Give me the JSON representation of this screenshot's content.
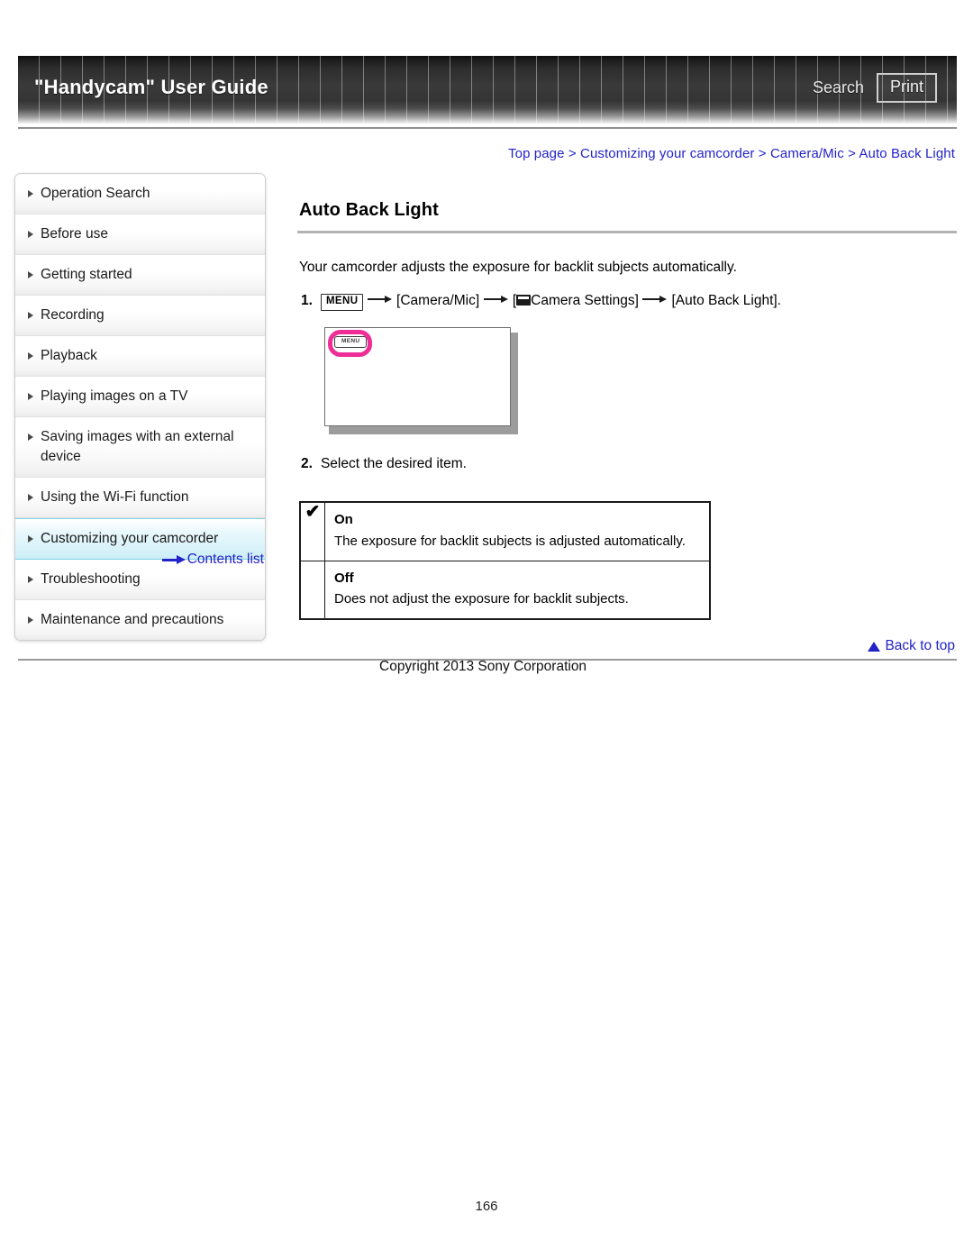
{
  "header": {
    "title": "\"Handycam\" User Guide",
    "search_label": "Search",
    "print_label": "Print"
  },
  "breadcrumb": {
    "full": "Top page > Customizing your camcorder > Camera/Mic > Auto Back Light",
    "items": [
      "Top page",
      "Customizing your camcorder",
      "Camera/Mic",
      "Auto Back Light"
    ],
    "separator": ">",
    "link_color": "#2323c8"
  },
  "sidebar": {
    "items": [
      {
        "label": "Operation Search",
        "selected": false
      },
      {
        "label": "Before use",
        "selected": false
      },
      {
        "label": "Getting started",
        "selected": false
      },
      {
        "label": "Recording",
        "selected": false
      },
      {
        "label": "Playback",
        "selected": false
      },
      {
        "label": "Playing images on a TV",
        "selected": false
      },
      {
        "label": "Saving images with an external device",
        "selected": false
      },
      {
        "label": "Using the Wi-Fi function",
        "selected": false
      },
      {
        "label": "Customizing your camcorder",
        "selected": true
      },
      {
        "label": "Troubleshooting",
        "selected": false
      },
      {
        "label": "Maintenance and precautions",
        "selected": false
      }
    ],
    "contents_list_label": "Contents list",
    "selected_bg_color": "#cdeef7",
    "selected_border_color": "#7fd2e6"
  },
  "main": {
    "title": "Auto Back Light",
    "intro": "Your camcorder adjusts the exposure for backlit subjects automatically.",
    "step1": {
      "number": "1.",
      "menu_chip": "MENU",
      "part1": "[Camera/Mic]",
      "part2_prefix": "[",
      "part2": "Camera Settings]",
      "part3": "[Auto Back Light]."
    },
    "illustration": {
      "menu_chip": "MENU",
      "highlight_color": "#ef2d97"
    },
    "step2": {
      "number": "2.",
      "text": "Select the desired item."
    },
    "options": [
      {
        "checked": true,
        "check_glyph": "✔",
        "name": "On",
        "description": "The exposure for backlit subjects is adjusted automatically."
      },
      {
        "checked": false,
        "check_glyph": "",
        "name": "Off",
        "description": "Does not adjust the exposure for backlit subjects."
      }
    ]
  },
  "footer": {
    "back_to_top": "Back to top",
    "copyright": "Copyright 2013 Sony Corporation",
    "page_number": "166"
  }
}
